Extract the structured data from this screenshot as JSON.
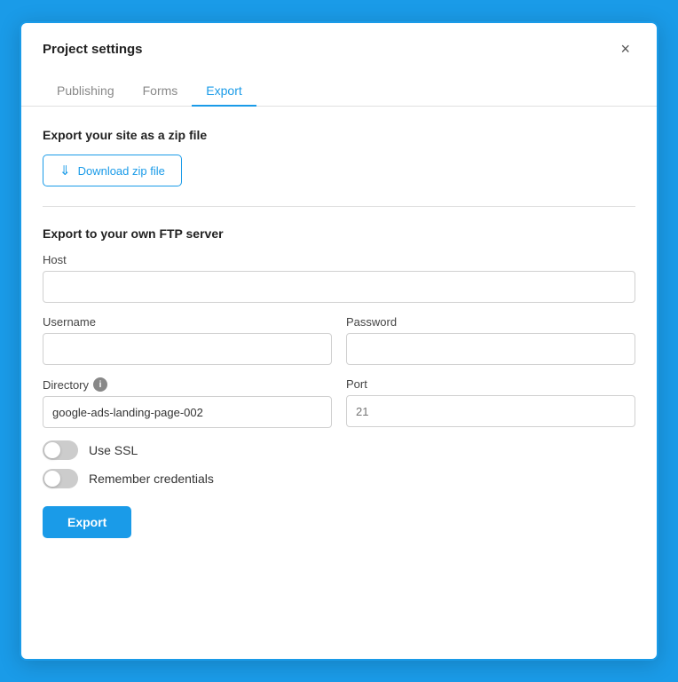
{
  "dialog": {
    "title": "Project settings",
    "close_label": "×"
  },
  "tabs": [
    {
      "id": "publishing",
      "label": "Publishing",
      "active": false
    },
    {
      "id": "forms",
      "label": "Forms",
      "active": false
    },
    {
      "id": "export",
      "label": "Export",
      "active": true
    }
  ],
  "export_section": {
    "zip_title": "Export your site as a zip file",
    "download_btn_label": "Download zip file",
    "ftp_title": "Export to your own FTP server",
    "fields": {
      "host_label": "Host",
      "host_placeholder": "",
      "username_label": "Username",
      "username_placeholder": "",
      "password_label": "Password",
      "password_placeholder": "",
      "directory_label": "Directory",
      "directory_value": "google-ads-landing-page-002",
      "port_label": "Port",
      "port_placeholder": "21"
    },
    "toggles": {
      "ssl_label": "Use SSL",
      "remember_label": "Remember credentials"
    },
    "export_btn_label": "Export"
  }
}
